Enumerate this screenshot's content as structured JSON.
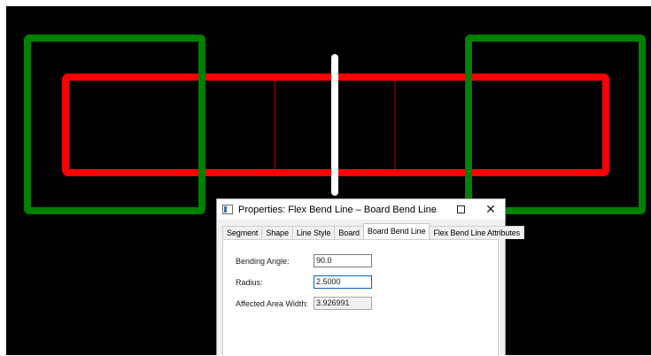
{
  "canvas": {
    "background": "#000000",
    "colors": {
      "flex_outline": "#ff0000",
      "rigid_outline": "#008000",
      "bend_line": "#ffffff",
      "guide_lines": "#c00000"
    }
  },
  "dialog": {
    "title": "Properties: Flex Bend Line – Board Bend Line",
    "tabs": [
      {
        "label": "Segment",
        "active": false
      },
      {
        "label": "Shape",
        "active": false
      },
      {
        "label": "Line Style",
        "active": false
      },
      {
        "label": "Board",
        "active": false
      },
      {
        "label": "Board Bend Line",
        "active": true
      },
      {
        "label": "Flex Bend Line Attributes",
        "active": false
      }
    ],
    "fields": {
      "bending_angle": {
        "label": "Bending Angle:",
        "value": "90.0"
      },
      "radius": {
        "label": "Radius:",
        "value": "2.5000"
      },
      "affected_width": {
        "label": "Affected Area Width:",
        "value": "3.926991"
      }
    },
    "window_buttons": {
      "minimize": "—",
      "close": "✕"
    }
  }
}
